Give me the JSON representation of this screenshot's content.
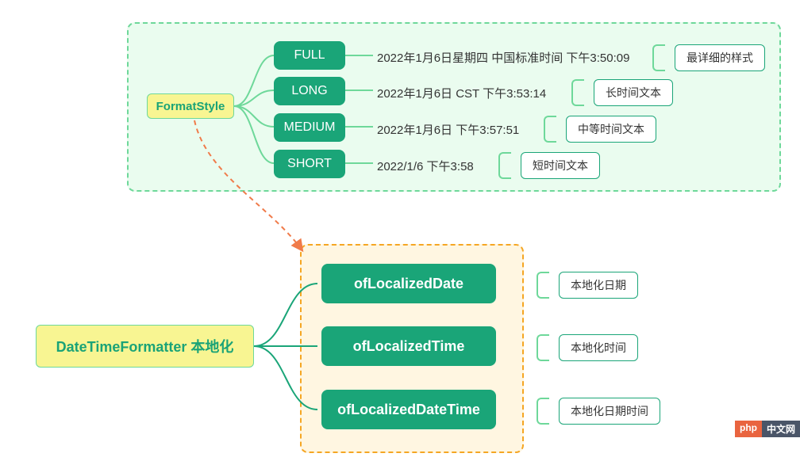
{
  "top": {
    "root": "FormatStyle",
    "items": [
      {
        "style": "FULL",
        "example": "2022年1月6日星期四 中国标准时间 下午3:50:09",
        "summary": "最详细的样式"
      },
      {
        "style": "LONG",
        "example": "2022年1月6日 CST 下午3:53:14",
        "summary": "长时间文本"
      },
      {
        "style": "MEDIUM",
        "example": "2022年1月6日 下午3:57:51",
        "summary": "中等时间文本"
      },
      {
        "style": "SHORT",
        "example": "2022/1/6 下午3:58",
        "summary": "短时间文本"
      }
    ]
  },
  "bottom": {
    "root": "DateTimeFormatter 本地化",
    "items": [
      {
        "method": "ofLocalizedDate",
        "summary": "本地化日期"
      },
      {
        "method": "ofLocalizedTime",
        "summary": "本地化时间"
      },
      {
        "method": "ofLocalizedDateTime",
        "summary": "本地化日期时间"
      }
    ]
  },
  "watermark": {
    "left": "php",
    "right": "中文网"
  }
}
